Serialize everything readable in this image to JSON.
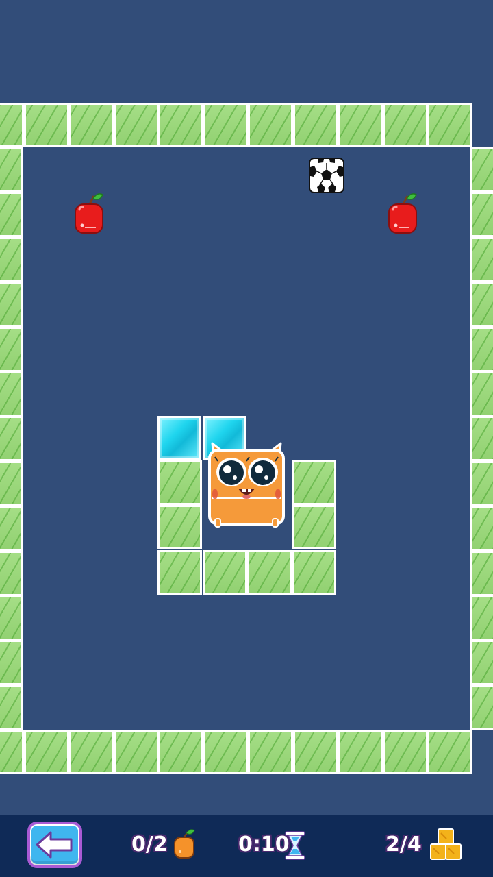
{
  "level": {
    "board_color": "#324d79",
    "grass_color": "#9bd97c",
    "ice_color": "#1fd5ee"
  },
  "items": {
    "apple_left": "apple-icon",
    "apple_right": "apple-icon",
    "ball": "soccer-ball-icon",
    "player": "orange-cat-block"
  },
  "hud": {
    "back_icon": "arrow-left-icon",
    "fruits_collected": "0/2",
    "fruit_icon": "orange-fruit-icon",
    "timer": "0:10",
    "timer_icon": "hourglass-icon",
    "blocks": "2/4",
    "blocks_icon": "crates-icon",
    "accent_color": "#3fb6ef"
  }
}
